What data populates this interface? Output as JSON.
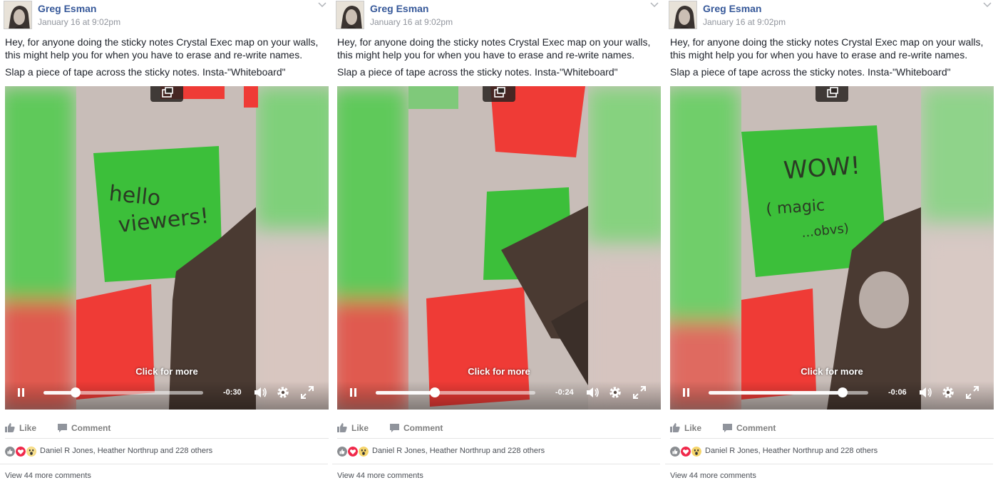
{
  "posts": [
    {
      "author": "Greg Esman",
      "timestamp": "January 16 at 9:02pm",
      "text1": "Hey, for anyone doing the sticky notes Crystal Exec map on your walls, this might help you for when you have to erase and re-write names.",
      "text2": "Slap a piece of tape across the sticky notes. Insta-\"Whiteboard\"",
      "video": {
        "click_more": "Click for more",
        "remaining": "-0:30",
        "progress": 0.2,
        "note_lines": [
          "hello",
          "viewers!"
        ]
      },
      "like": "Like",
      "comment": "Comment",
      "reaction_text": "Daniel R Jones, Heather Northrup and 228 others",
      "view_more": "View 44 more comments"
    },
    {
      "author": "Greg Esman",
      "timestamp": "January 16 at 9:02pm",
      "text1": "Hey, for anyone doing the sticky notes Crystal Exec map on your walls, this might help you for when you have to erase and re-write names.",
      "text2": "Slap a piece of tape across the sticky notes. Insta-\"Whiteboard\"",
      "video": {
        "click_more": "Click for more",
        "remaining": "-0:24",
        "progress": 0.37,
        "note_lines": []
      },
      "like": "Like",
      "comment": "Comment",
      "reaction_text": "Daniel R Jones, Heather Northrup and 228 others",
      "view_more": "View 44 more comments"
    },
    {
      "author": "Greg Esman",
      "timestamp": "January 16 at 9:02pm",
      "text1": "Hey, for anyone doing the sticky notes Crystal Exec map on your walls, this might help you for when you have to erase and re-write names.",
      "text2": "Slap a piece of tape across the sticky notes. Insta-\"Whiteboard\"",
      "video": {
        "click_more": "Click for more",
        "remaining": "-0:06",
        "progress": 0.84,
        "note_lines": [
          "WOW!",
          "( magic",
          "...obvs)"
        ]
      },
      "like": "Like",
      "comment": "Comment",
      "reaction_text": "Daniel R Jones, Heather Northrup and 228 others",
      "view_more": "View 44 more comments"
    }
  ],
  "colors": {
    "author_link": "#365899",
    "timestamp": "#90949c",
    "sticky_green": "#3cbf3a",
    "sticky_red": "#ef3b36",
    "hand": "#4a3a32",
    "reaction_love": "#f0284a"
  },
  "icons": [
    "avatar",
    "chevron-down-icon",
    "popout-icon",
    "pause-icon",
    "volume-icon",
    "gear-icon",
    "fullscreen-icon",
    "like-icon",
    "comment-icon",
    "like-reaction-icon",
    "love-reaction-icon",
    "wow-reaction-icon"
  ]
}
